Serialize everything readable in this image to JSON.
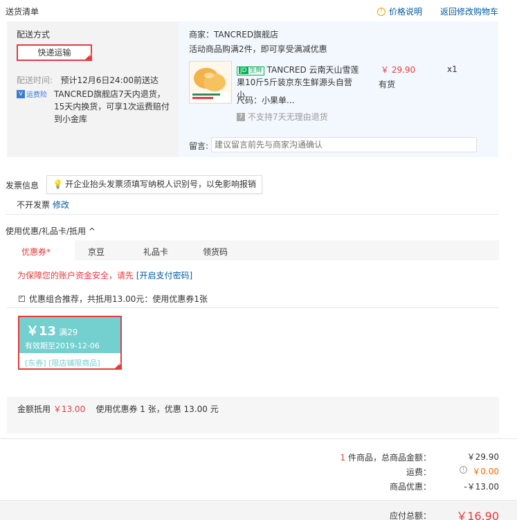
{
  "header": {
    "title": "送货清单",
    "price_note": "价格说明",
    "back_link": "返回修改购物车"
  },
  "shipping": {
    "method_label": "配送方式",
    "method_value": "快递运输",
    "time_label": "配送时间:",
    "time_value": "预计12月6日24:00前送达",
    "insurance_badge": "运费险",
    "policy": "TANCRED旗舰店7天内退货，15天内换货，可享1次运费赔付到小金库"
  },
  "shop": {
    "name": "商家：TANCRED旗舰店",
    "promo": "活动商品购满2件，即可享受满减优惠"
  },
  "product": {
    "tag": "生鲜",
    "title": "TANCRED 云南天山雪莲果10斤5斤装京东生鲜源头自营 小",
    "price": "￥ 29.90",
    "qty": "x1",
    "stock": "有货",
    "spec": "尺码：小果单...",
    "no_return": "不支持7天无理由退货"
  },
  "message": {
    "label": "留言:",
    "placeholder": "建议留言前先与商家沟通确认"
  },
  "invoice": {
    "label": "发票信息",
    "tip": "开企业抬头发票须填写纳税人识别号，以免影响报销",
    "value": "不开发票",
    "edit": "修改"
  },
  "coupons": {
    "title": "使用优惠/礼品卡/抵用 ^",
    "tabs": [
      "优惠券*",
      "京豆",
      "礼品卡",
      "领货码"
    ],
    "safety_msg": "为保障您的账户资金安全，请先 ",
    "safety_link": "[开启支付密码]",
    "combo": "优惠组合推荐，共抵用13.00元：使用优惠券1张",
    "card": {
      "amount": "￥13",
      "condition": "满29",
      "expiry": "有效期至2019-12-06",
      "tags": "[东券]  [限店铺限商品]"
    },
    "deduct_label": "金额抵用",
    "deduct_value": "￥13.00",
    "deduct_detail": "使用优惠券 1 张，优惠 13.00 元"
  },
  "totals": {
    "items_count": "1",
    "items_label": " 件商品，总商品金额：",
    "items_value": "￥29.90",
    "shipping_label": "运费：",
    "shipping_value": "￥0.00",
    "discount_label": "商品优惠：",
    "discount_value": "-￥13.00",
    "pay_label": "应付总额：",
    "pay_value": "￥16.90"
  }
}
